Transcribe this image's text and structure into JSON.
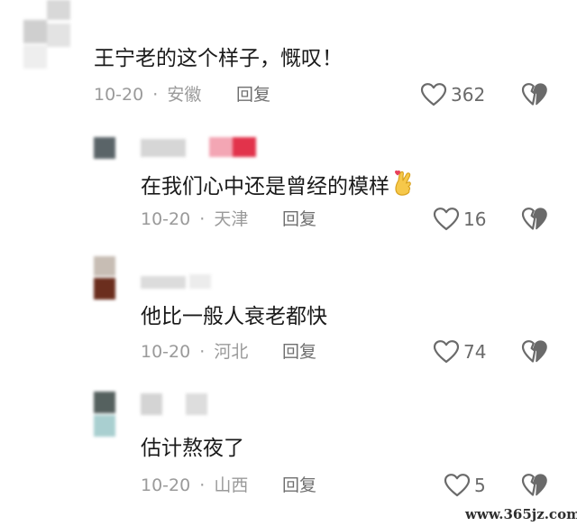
{
  "colors": {
    "comment_text": "#1a1a1a",
    "meta_text": "#9a9a9a",
    "icon_gray": "#6a6a6a",
    "background": "#ffffff"
  },
  "comments": [
    {
      "text": "王宁老的这个样子，慨叹！",
      "date": "10-20",
      "separator": "·",
      "location": "安徽",
      "reply_label": "回复",
      "likes": "362",
      "like_icon": "heart-outline-icon",
      "dislike_icon": "broken-heart-icon"
    },
    {
      "text": "在我们心中还是曾经的模样",
      "emoji": "🤞",
      "date": "10-20",
      "separator": "·",
      "location": "天津",
      "reply_label": "回复",
      "likes": "16",
      "like_icon": "heart-outline-icon",
      "dislike_icon": "broken-heart-icon"
    },
    {
      "text": "他比一般人衰老都快",
      "date": "10-20",
      "separator": "·",
      "location": "河北",
      "reply_label": "回复",
      "likes": "74",
      "like_icon": "heart-outline-icon",
      "dislike_icon": "broken-heart-icon"
    },
    {
      "text": "估计熬夜了",
      "date": "10-20",
      "separator": "·",
      "location": "山西",
      "reply_label": "回复",
      "likes": "5",
      "like_icon": "heart-outline-icon",
      "dislike_icon": "broken-heart-icon"
    }
  ],
  "watermark": "www.365jz.com"
}
